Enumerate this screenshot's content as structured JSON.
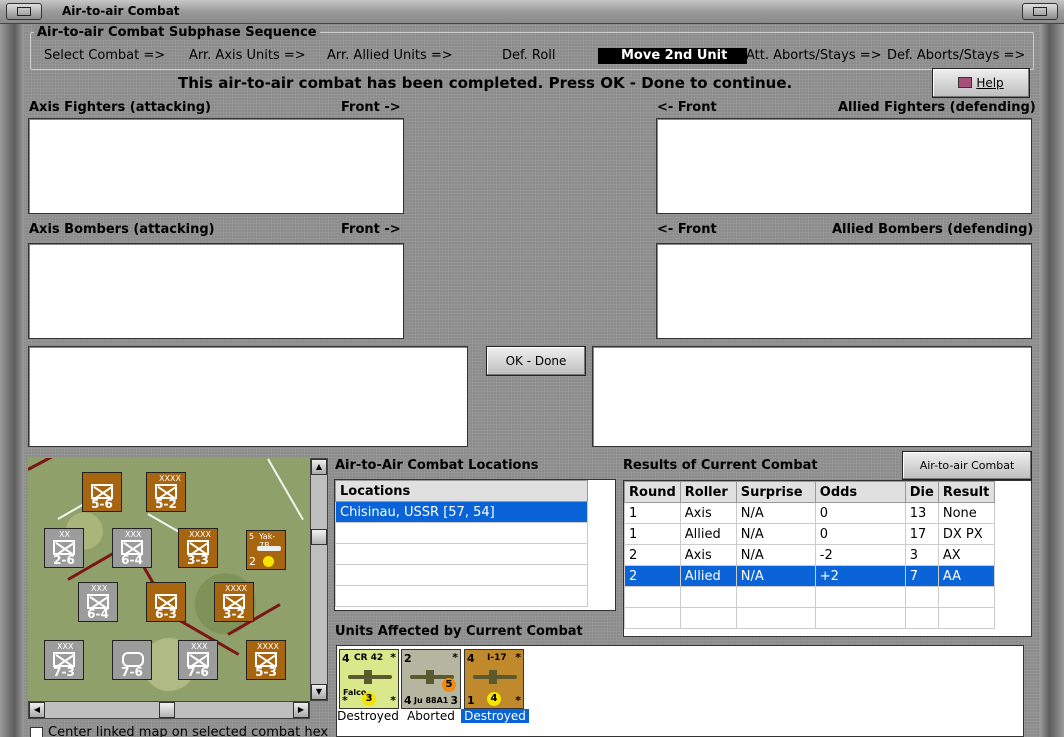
{
  "window": {
    "title": "Air-to-air Combat"
  },
  "subphase": {
    "label": "Air-to-air Combat Subphase Sequence",
    "steps": [
      "Select Combat =>",
      "Arr. Axis Units =>",
      "Arr. Allied Units =>",
      "Def. Roll",
      "Move 2nd Unit",
      "Att. Aborts/Stays =>",
      "Def. Aborts/Stays =>"
    ],
    "active_step": "Move 2nd Unit"
  },
  "message": "This air-to-air combat has been completed.  Press OK - Done to continue.",
  "help_label": "Help",
  "boxes": {
    "axis_fighters": "Axis Fighters (attacking)",
    "axis_bombers": "Axis Bombers (attacking)",
    "allied_fighters": "Allied Fighters (defending)",
    "allied_bombers": "Allied Bombers (defending)",
    "front_right": "Front ->",
    "front_left": "<- Front"
  },
  "ok_label": "OK - Done",
  "locations": {
    "title": "Air-to-Air Combat Locations",
    "header": "Locations",
    "rows": [
      "Chisinau, USSR [57, 54]"
    ]
  },
  "results": {
    "title": "Results of Current Combat",
    "chart_button": "Air-to-air Combat Chart",
    "columns": [
      "Round",
      "Roller",
      "Surprise",
      "Odds",
      "Die",
      "Result"
    ],
    "rows": [
      [
        "1",
        "Axis",
        "N/A",
        "0",
        "13",
        "None"
      ],
      [
        "1",
        "Allied",
        "N/A",
        "0",
        "17",
        "DX PX"
      ],
      [
        "2",
        "Axis",
        "N/A",
        "-2",
        "3",
        "AX"
      ],
      [
        "2",
        "Allied",
        "N/A",
        "+2",
        "7",
        "AA"
      ]
    ],
    "selected_row": 3
  },
  "units": {
    "title": "Units Affected by Current Combat",
    "items": [
      {
        "top_left": "4",
        "name": "CR 42",
        "sub": "Falco",
        "bottom_left": "*",
        "die": "3",
        "bottom_right": "*",
        "top_right": "*",
        "status": "Destroyed"
      },
      {
        "top_left": "2",
        "name": "Ju 88A1",
        "sub": "",
        "bottom_left": "4",
        "die": "5",
        "bottom_right": "3",
        "top_right": "*",
        "status": "Aborted"
      },
      {
        "top_left": "4",
        "name": "I-17",
        "sub": "",
        "bottom_left": "1",
        "die": "4",
        "bottom_right": "*",
        "top_right": "*",
        "status": "Destroyed"
      }
    ]
  },
  "map_counters": [
    {
      "top": "",
      "name": "",
      "value": "5-6"
    },
    {
      "top": "XXXX",
      "name": "",
      "value": "5-2"
    },
    {
      "top": "XX",
      "name": "",
      "value": "2-6"
    },
    {
      "top": "XXX",
      "name": "",
      "value": "6-4"
    },
    {
      "top": "XXXX",
      "name": "",
      "value": "3-3"
    },
    {
      "top": "5",
      "name": "Yak-7B",
      "value": "2"
    },
    {
      "top": "XXX",
      "name": "",
      "value": "6-4"
    },
    {
      "top": "",
      "name": "",
      "value": "6-3"
    },
    {
      "top": "XXXX",
      "name": "",
      "value": "3-2"
    },
    {
      "top": "XXX",
      "name": "",
      "value": "7-3"
    },
    {
      "top": "",
      "name": "",
      "value": "7-6"
    },
    {
      "top": "XXX",
      "name": "",
      "value": "7-6"
    },
    {
      "top": "XXXX",
      "name": "",
      "value": "5-3"
    }
  ],
  "map_checkbox_label": "Center linked map on selected combat hex",
  "colors": {
    "accent": "#0a64d8",
    "counter_brown": "#a8650f",
    "counter_grey": "#9c9c9c"
  }
}
